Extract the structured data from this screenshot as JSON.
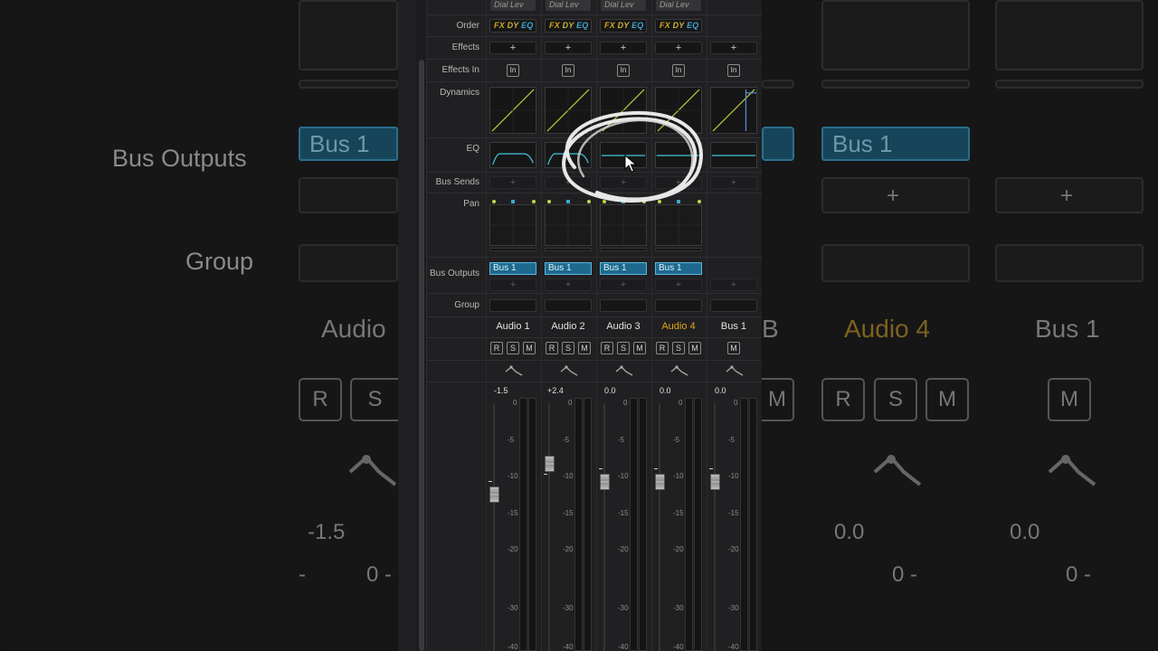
{
  "background": {
    "labels": {
      "bus_outputs": "Bus Outputs",
      "group": "Group"
    },
    "chips": [
      "Bus 1",
      "Bus 1"
    ],
    "names": [
      "Audio",
      "B",
      "Audio 4",
      "Bus 1"
    ],
    "buttons": [
      "R",
      "S",
      "M",
      "R",
      "S",
      "M",
      "M"
    ],
    "values": [
      "-1.5",
      "0.0",
      "0.0"
    ],
    "plus": [
      "+",
      "+"
    ],
    "zeros": [
      "0 -",
      "0 -",
      "0 -",
      "-"
    ]
  },
  "row_labels": {
    "order": "Order",
    "effects": "Effects",
    "effects_in": "Effects In",
    "dynamics": "Dynamics",
    "eq": "EQ",
    "bus_sends": "Bus Sends",
    "pan": "Pan",
    "bus_outputs": "Bus Outputs",
    "group": "Group"
  },
  "order_tags": {
    "fx": "FX",
    "dy": "DY",
    "eq": "EQ"
  },
  "strips": [
    {
      "dial": "Dial Lev",
      "name": "Audio 1",
      "output": "Bus 1",
      "gain": "-1.5",
      "in": "In",
      "plus": "+",
      "send": "+",
      "out_plus": "+",
      "r": "R",
      "s": "S",
      "m": "M"
    },
    {
      "dial": "Dial Lev",
      "name": "Audio 2",
      "output": "Bus 1",
      "gain": "+2.4",
      "in": "In",
      "plus": "+",
      "send": "+",
      "out_plus": "+",
      "r": "R",
      "s": "S",
      "m": "M"
    },
    {
      "dial": "Dial Lev",
      "name": "Audio 3",
      "output": "Bus 1",
      "gain": "0.0",
      "in": "In",
      "plus": "+",
      "send": "+",
      "out_plus": "+",
      "r": "R",
      "s": "S",
      "m": "M"
    },
    {
      "dial": "Dial Lev",
      "name": "Audio 4",
      "output": "Bus 1",
      "gain": "0.0",
      "in": "In",
      "plus": "+",
      "send": "+",
      "out_plus": "+",
      "r": "R",
      "s": "S",
      "m": "M"
    },
    {
      "name": "Bus 1",
      "gain": "0.0",
      "in": "In",
      "plus": "+",
      "send": "+",
      "out_plus": "+",
      "m": "M"
    }
  ],
  "scale": [
    "0",
    "-5",
    "-10",
    "-15",
    "-20",
    "-30",
    "-40"
  ],
  "colors": {
    "accent_yellow": "#e3a41a",
    "bus_blue": "#1e6a8e",
    "eq_cyan": "#3fc5d6",
    "dynamics_green": "#b7c93a"
  }
}
